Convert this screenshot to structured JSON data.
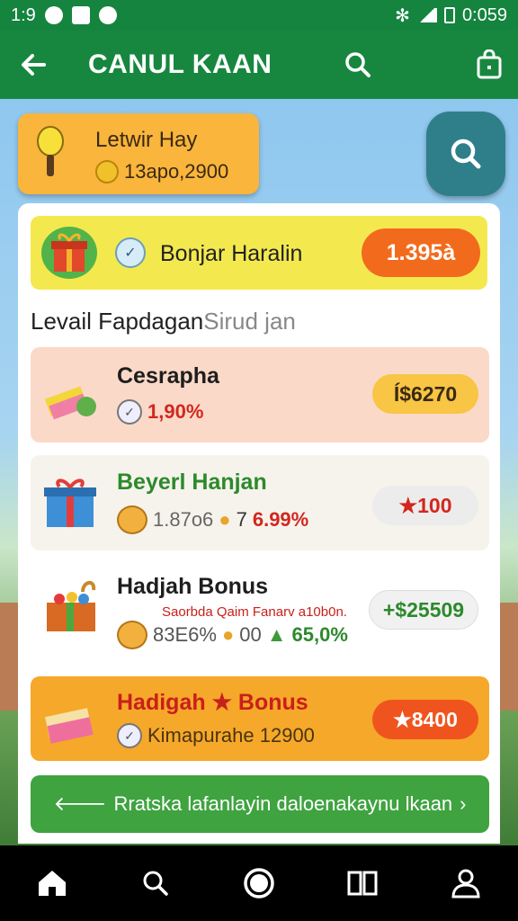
{
  "status_bar": {
    "time": "1:9",
    "clock": "0:059"
  },
  "app_bar": {
    "title": "CANUL KAAN"
  },
  "user_card": {
    "name": "Letwir Hay",
    "coins": "13apo,2900"
  },
  "banner": {
    "label": "Bonjar Haralin",
    "value": "1.395à"
  },
  "section": {
    "title_main": "Levail Fapdagan",
    "title_faded": "Sirud jan"
  },
  "items": [
    {
      "name": "Cesrapha",
      "sub": "1,90%",
      "value": "Í$6270",
      "name_color": "#1e1e1e",
      "sub_color": "#d2271f"
    },
    {
      "name": "Beyerl Hanjan",
      "sub_a": "1.87o6",
      "sub_b": "7",
      "sub_c": "6.99%",
      "value": "★100",
      "name_color": "#2c8a2c"
    },
    {
      "name": "Hadjah Bonus",
      "sub_top": "Saorbda Qaim Fanarv a10b0n.",
      "sub_a": "83E6%",
      "sub_b": "00",
      "sub_c": "65,0%",
      "value": "+$25509"
    },
    {
      "name": "Hadigah ★ Bonus",
      "sub": "Kimapurahe 12900",
      "value": "★8400",
      "name_color": "#c8201a"
    }
  ],
  "cta": {
    "label": "Rratska lafanlayin daloenakaynu lkaan"
  },
  "colors": {
    "appbar": "#17873f",
    "banner_pill": "#f26b1d",
    "cta": "#3fa340"
  },
  "icons": [
    "arrow-left-icon",
    "search-icon",
    "shopping-bag-icon",
    "home-icon",
    "circle-icon",
    "book-icon",
    "profile-icon"
  ]
}
